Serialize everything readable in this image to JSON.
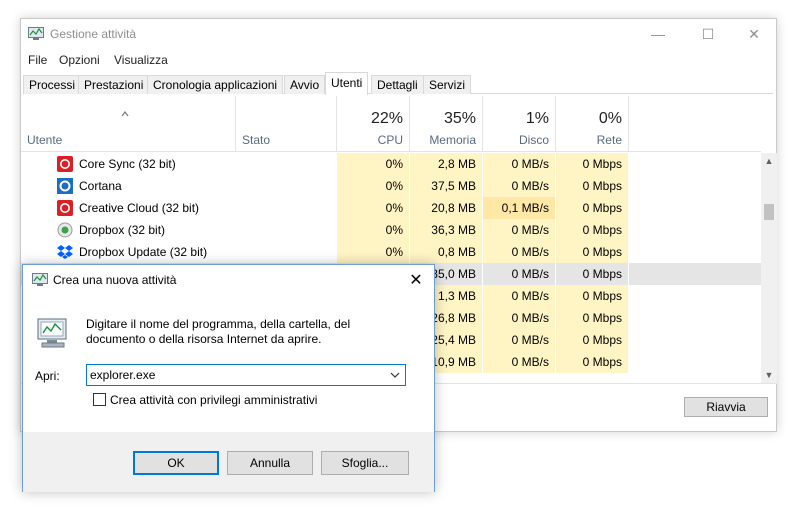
{
  "window": {
    "title": "Gestione attività",
    "minimize": "—",
    "maximize": "☐",
    "close": "✕"
  },
  "menu": [
    "File",
    "Opzioni",
    "Visualizza"
  ],
  "tabs": [
    "Processi",
    "Prestazioni",
    "Cronologia applicazioni",
    "Avvio",
    "Utenti",
    "Dettagli",
    "Servizi"
  ],
  "active_tab": "Utenti",
  "columns": {
    "user": "Utente",
    "status": "Stato",
    "cpu": {
      "pct": "22%",
      "label": "CPU"
    },
    "memory": {
      "pct": "35%",
      "label": "Memoria"
    },
    "disk": {
      "pct": "1%",
      "label": "Disco"
    },
    "network": {
      "pct": "0%",
      "label": "Rete"
    }
  },
  "rows": [
    {
      "name": "Core Sync (32 bit)",
      "icon": "adobe-cc-icon",
      "cpu": "0%",
      "mem": "2,8 MB",
      "disk": "0 MB/s",
      "net": "0 Mbps"
    },
    {
      "name": "Cortana",
      "icon": "cortana-icon",
      "cpu": "0%",
      "mem": "37,5 MB",
      "disk": "0 MB/s",
      "net": "0 Mbps"
    },
    {
      "name": "Creative Cloud (32 bit)",
      "icon": "adobe-cc-icon",
      "cpu": "0%",
      "mem": "20,8 MB",
      "disk": "0,1 MB/s",
      "net": "0 Mbps"
    },
    {
      "name": "Dropbox (32 bit)",
      "icon": "dropbox-sync-icon",
      "cpu": "0%",
      "mem": "36,3 MB",
      "disk": "0 MB/s",
      "net": "0 Mbps"
    },
    {
      "name": "Dropbox Update (32 bit)",
      "icon": "dropbox-icon",
      "cpu": "0%",
      "mem": "0,8 MB",
      "disk": "0 MB/s",
      "net": "0 Mbps"
    },
    {
      "name": "",
      "icon": "",
      "cpu": "",
      "mem": "35,0 MB",
      "disk": "0 MB/s",
      "net": "0 Mbps"
    },
    {
      "name": "",
      "icon": "",
      "cpu": "",
      "mem": "1,3 MB",
      "disk": "0 MB/s",
      "net": "0 Mbps"
    },
    {
      "name": "",
      "icon": "",
      "cpu": "",
      "mem": "26,8 MB",
      "disk": "0 MB/s",
      "net": "0 Mbps"
    },
    {
      "name": "",
      "icon": "",
      "cpu": "",
      "mem": "25,4 MB",
      "disk": "0 MB/s",
      "net": "0 Mbps"
    },
    {
      "name": "",
      "icon": "",
      "cpu": "",
      "mem": "10,9 MB",
      "disk": "0 MB/s",
      "net": "0 Mbps"
    }
  ],
  "restart_button": "Riavvia",
  "dialog": {
    "title": "Crea una nuova attività",
    "close": "✕",
    "description_line1": "Digitare il nome del programma, della cartella, del",
    "description_line2": "documento o della risorsa Internet da aprire.",
    "open_label": "Apri:",
    "open_value": "explorer.exe",
    "admin_checkbox_label": "Crea attività con privilegi amministrativi",
    "ok": "OK",
    "cancel": "Annulla",
    "browse": "Sfoglia..."
  }
}
